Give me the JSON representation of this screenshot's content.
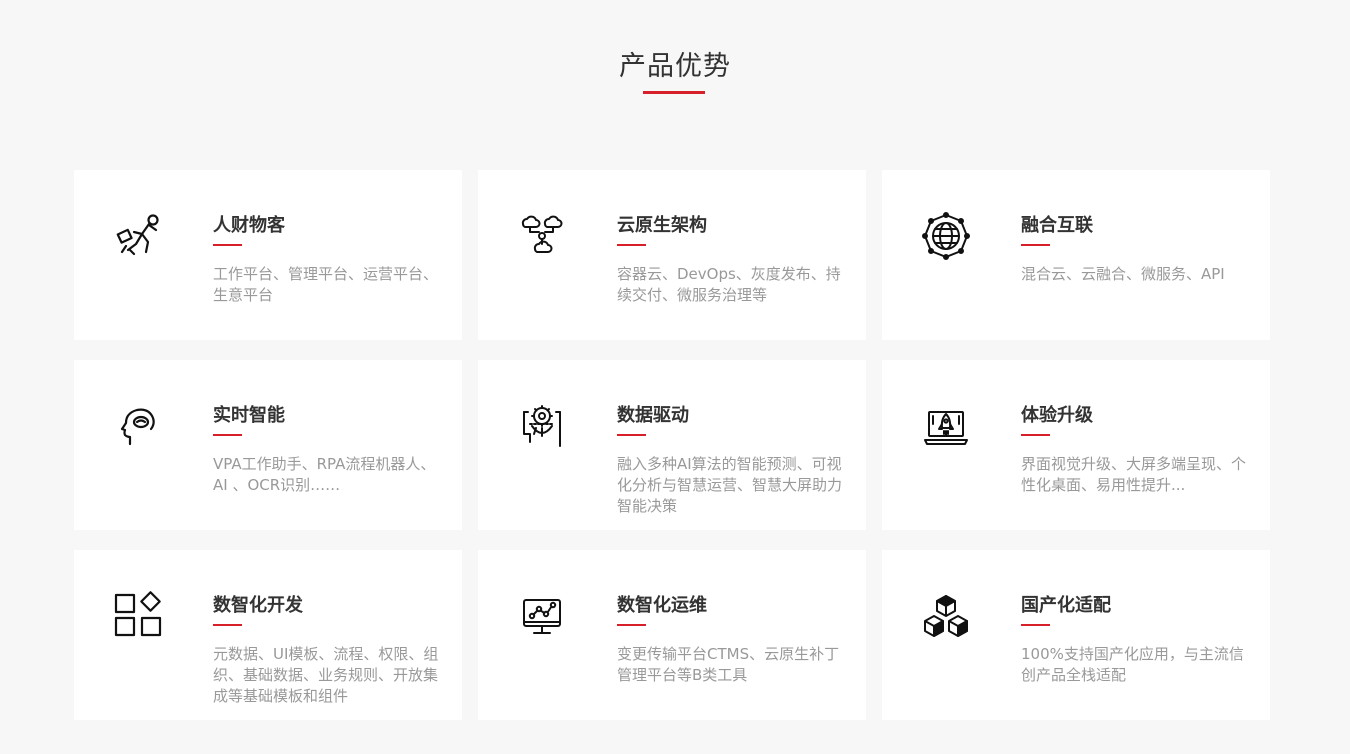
{
  "section": {
    "title": "产品优势"
  },
  "colors": {
    "accent": "#d7202a",
    "card_bg": "#ffffff",
    "page_bg": "#f7f7f7",
    "title_text": "#333333",
    "desc_text": "#999999"
  },
  "cards": [
    {
      "title": "人财物客",
      "desc": "工作平台、管理平台、运营平台、生意平台",
      "icon": "running-man-icon"
    },
    {
      "title": "云原生架构",
      "desc": "容器云、DevOps、灰度发布、持续交付、微服务治理等",
      "icon": "cloud-network-icon"
    },
    {
      "title": "融合互联",
      "desc": "混合云、云融合、微服务、API",
      "icon": "globe-network-icon"
    },
    {
      "title": "实时智能",
      "desc": "VPA工作助手、RPA流程机器人、AI 、OCR识别……",
      "icon": "brain-head-icon"
    },
    {
      "title": "数据驱动",
      "desc": "融入多种AI算法的智能预测、可视化分析与智慧运营、智慧大屏助力智能决策",
      "icon": "data-head-icon"
    },
    {
      "title": "体验升级",
      "desc": "界面视觉升级、大屏多端呈现、个性化桌面、易用性提升...",
      "icon": "laptop-rocket-icon"
    },
    {
      "title": "数智化开发",
      "desc": "元数据、UI模板、流程、权限、组织、基础数据、业务规则、开放集成等基础模板和组件",
      "icon": "modules-icon"
    },
    {
      "title": "数智化运维",
      "desc": "变更传输平台CTMS、云原生补丁管理平台等B类工具",
      "icon": "monitor-chart-icon"
    },
    {
      "title": "国产化适配",
      "desc": "100%支持国产化应用，与主流信创产品全栈适配",
      "icon": "cubes-icon"
    }
  ]
}
